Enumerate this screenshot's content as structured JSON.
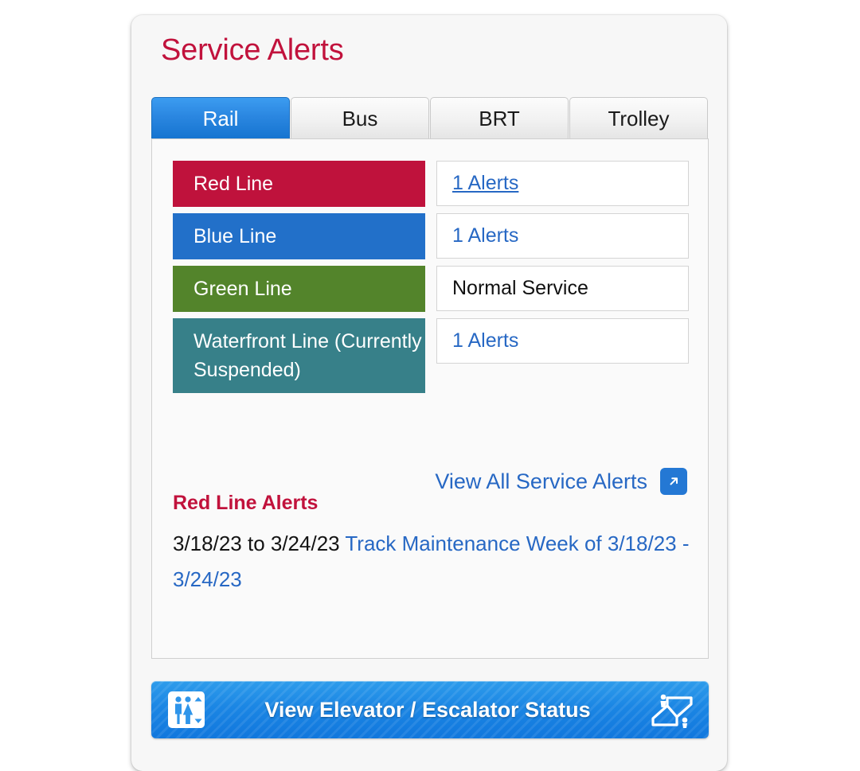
{
  "widget": {
    "title": "Service Alerts"
  },
  "tabs": [
    {
      "label": "Rail",
      "active": true
    },
    {
      "label": "Bus",
      "active": false
    },
    {
      "label": "BRT",
      "active": false
    },
    {
      "label": "Trolley",
      "active": false
    }
  ],
  "lines": [
    {
      "name": "Red Line",
      "color": "#bf123c",
      "status": "1 Alerts",
      "status_is_link": true,
      "status_hovered": true
    },
    {
      "name": "Blue Line",
      "color": "#2270c9",
      "status": "1 Alerts",
      "status_is_link": true,
      "status_hovered": false
    },
    {
      "name": "Green Line",
      "color": "#53842b",
      "status": "Normal Service",
      "status_is_link": false,
      "status_hovered": false
    },
    {
      "name": "Waterfront Line (Currently Suspended)",
      "color": "#378089",
      "status": "1 Alerts",
      "status_is_link": true,
      "status_hovered": false
    }
  ],
  "view_all": {
    "label": "View All Service Alerts",
    "icon": "external-link-arrow-icon",
    "icon_color": "#2478d4"
  },
  "alert_detail": {
    "heading": "Red Line Alerts",
    "date_range": "3/18/23 to 3/24/23",
    "link_text": "Track Maintenance Week of 3/18/23 - 3/24/23"
  },
  "elevator_cta": {
    "label": "View Elevator / Escalator Status",
    "left_icon": "elevator-icon",
    "right_icon": "escalator-icon",
    "color": "#1b86e4"
  }
}
